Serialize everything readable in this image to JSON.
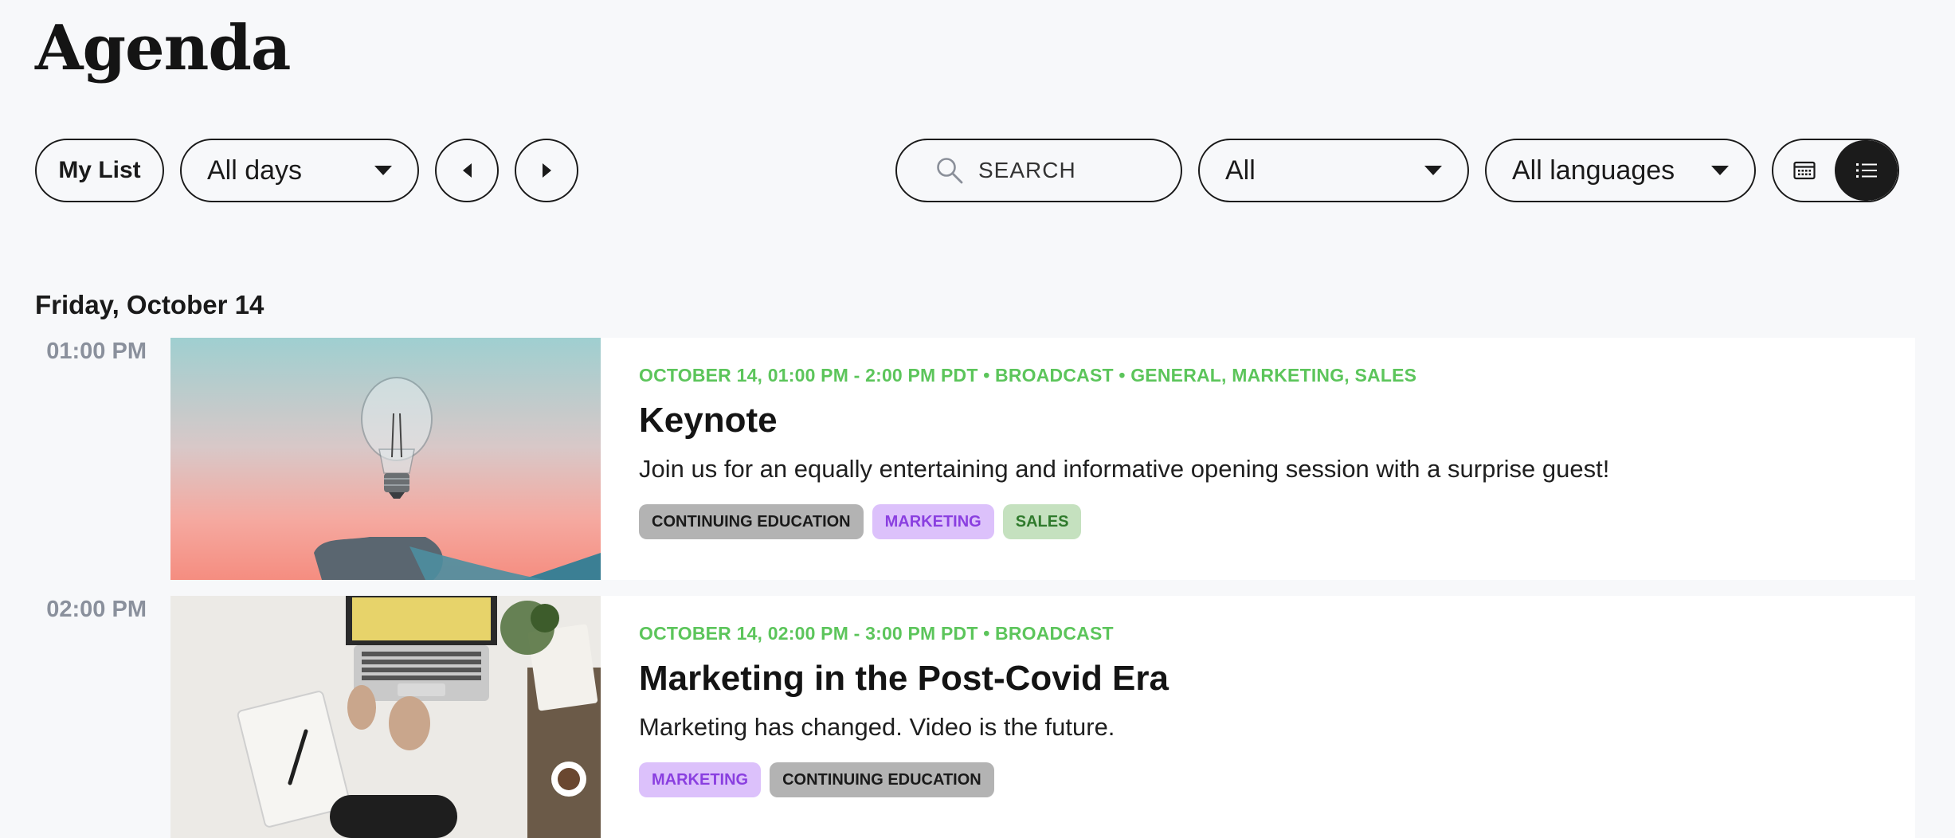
{
  "page": {
    "title": "Agenda"
  },
  "filters": {
    "my_list_label": "My List",
    "days_value": "All days",
    "search_placeholder": "SEARCH",
    "category_value": "All",
    "language_value": "All languages"
  },
  "icons": {
    "search": "search-icon",
    "prev": "caret-left-icon",
    "next": "caret-right-icon",
    "calendar_view": "calendar-icon",
    "list_view": "list-icon",
    "dropdown": "chevron-down-icon"
  },
  "colors": {
    "meta_green": "#5cc55b",
    "active_toggle": "#1b1b1b",
    "tag_education_bg": "#b3b3b3",
    "tag_marketing_bg": "#dcc1fb",
    "tag_marketing_text": "#8a3fe0",
    "tag_sales_bg": "#c5e1bf",
    "tag_sales_text": "#2f7a2c"
  },
  "agenda": {
    "day_heading": "Friday, October 14",
    "sessions": [
      {
        "time": "01:00 PM",
        "meta": "OCTOBER 14, 01:00 PM - 2:00 PM PDT • BROADCAST • GENERAL, MARKETING, SALES",
        "title": "Keynote",
        "description": "Join us for an equally entertaining and informative opening session with a surprise guest!",
        "tags": [
          "CONTINUING EDUCATION",
          "MARKETING",
          "SALES"
        ]
      },
      {
        "time": "02:00 PM",
        "meta": "OCTOBER 14, 02:00 PM - 3:00 PM PDT • BROADCAST",
        "title": "Marketing in the Post-Covid Era",
        "description": "Marketing has changed. Video is the future.",
        "tags": [
          "MARKETING",
          "CONTINUING EDUCATION"
        ]
      }
    ]
  }
}
